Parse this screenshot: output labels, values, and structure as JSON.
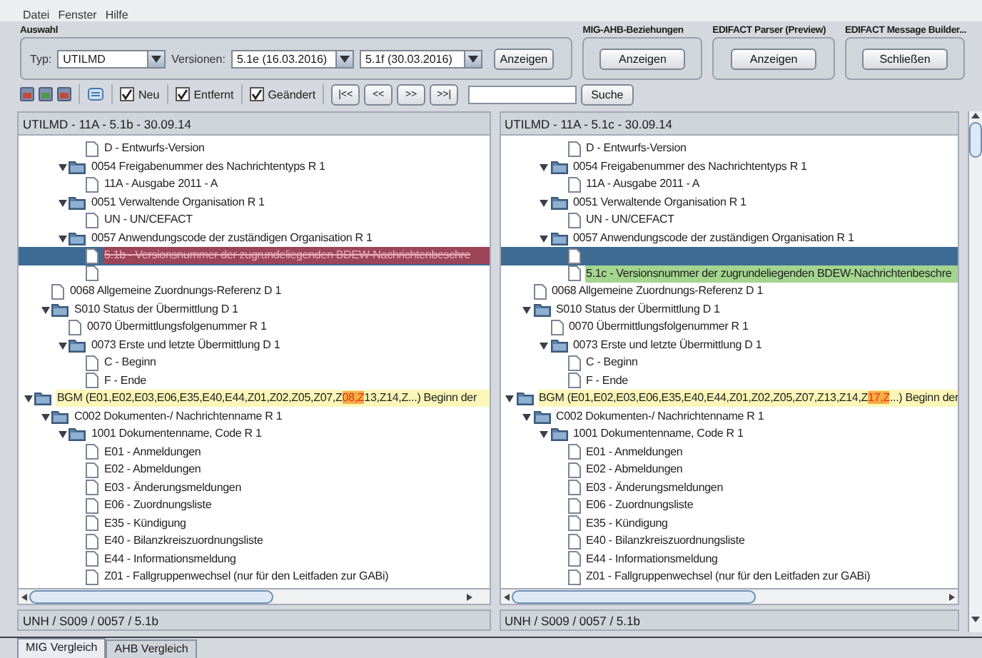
{
  "menu": [
    {
      "label": "Datei"
    },
    {
      "label": "Fenster"
    },
    {
      "label": "Hilfe"
    }
  ],
  "groups": [
    {
      "kind": "selection",
      "title": "Auswahl",
      "type_label": "Typ:",
      "type_value": "UTILMD",
      "versions_label": "Versionen:",
      "versions": [
        "5.1e (16.03.2016)",
        "5.1f (30.03.2016)"
      ],
      "button": "Anzeigen"
    },
    {
      "kind": "action",
      "title": "MIG-AHB-Beziehungen",
      "button": "Anzeigen"
    },
    {
      "kind": "action",
      "title": "EDIFACT Parser (Preview)",
      "button": "Anzeigen"
    },
    {
      "kind": "action",
      "title": "EDIFACT Message Builder...",
      "button": "Schließen"
    }
  ],
  "toolbar": {
    "filters": [
      {
        "label": "Neu",
        "checked": true
      },
      {
        "label": "Entfernt",
        "checked": true
      },
      {
        "label": "Geändert",
        "checked": true
      }
    ],
    "nav": [
      "|<<",
      "<<",
      ">>",
      ">>|"
    ],
    "search_button": "Suche"
  },
  "panes": [
    {
      "header": "UTILMD - 11A - 5.1b - 30.09.14",
      "status": "UNH / S009 / 0057 / 5.1b",
      "tree": [
        {
          "children": [
            {
              "children": [
                {
                  "children": [
                    {
                      "kind": "doc",
                      "label": "D - Entwurfs-Version",
                      "selected": false
                    }
                  ]
                },
                {
                  "kind": "folder",
                  "expanded": true,
                  "label": "0054 Freigabenummer des Nachrichtentyps R 1",
                  "selected": false,
                  "children": [
                    {
                      "kind": "doc",
                      "label": "11A - Ausgabe 2011 - A",
                      "selected": false
                    }
                  ]
                },
                {
                  "kind": "folder",
                  "expanded": true,
                  "label": "0051 Verwaltende Organisation R 1",
                  "selected": false,
                  "children": [
                    {
                      "kind": "doc",
                      "label": "UN - UN/CEFACT",
                      "selected": false
                    }
                  ]
                },
                {
                  "kind": "folder",
                  "expanded": true,
                  "label": "0057 Anwendungscode der zuständigen Organisation R 1",
                  "selected": false,
                  "children": [
                    {
                      "kind": "doc",
                      "label": "5.1b - Versionsnummer der zugrundeliegenden BDEW-Nachrichtenbeschre",
                      "selected": true,
                      "color": "#9c4458",
                      "crossed_out": true
                    },
                    {
                      "kind": "doc",
                      "selected": false
                    }
                  ]
                }
              ]
            },
            {
              "kind": "doc",
              "label": "0068 Allgemeine Zuordnungs-Referenz D 1",
              "selected": false
            },
            {
              "kind": "folder",
              "expanded": true,
              "label": "S010 Status der Übermittlung D 1",
              "selected": false,
              "children": [
                {
                  "kind": "doc",
                  "label": "0070 Übermittlungsfolgenummer R 1",
                  "selected": false
                },
                {
                  "kind": "folder",
                  "expanded": true,
                  "label": "0073 Erste und letzte Übermittlung D 1",
                  "selected": false,
                  "children": [
                    {
                      "kind": "doc",
                      "label": "C - Beginn",
                      "selected": false
                    },
                    {
                      "kind": "doc",
                      "label": "F - Ende",
                      "selected": false
                    }
                  ]
                }
              ]
            }
          ]
        },
        {
          "kind": "folder",
          "expanded": true,
          "selected": false,
          "color": "#fbf7b8",
          "parts": [
            {
              "text": "BGM (E01,E02,E03,E06,E35,E40,E44,Z01,Z02,Z05,Z07,Z",
              "highlighted": false
            },
            {
              "text": "08,Z",
              "highlighted": true
            },
            {
              "text": "13,Z14,Z...) Beginn der",
              "highlighted": false
            }
          ],
          "children": [
            {
              "kind": "folder",
              "expanded": true,
              "label": "C002 Dokumenten-/ Nachrichtenname R 1",
              "selected": false,
              "children": [
                {
                  "kind": "folder",
                  "expanded": true,
                  "label": "1001 Dokumentenname, Code R 1",
                  "selected": false,
                  "children": [
                    {
                      "kind": "doc",
                      "label": "E01 - Anmeldungen",
                      "selected": false
                    },
                    {
                      "kind": "doc",
                      "label": "E02 - Abmeldungen",
                      "selected": false
                    },
                    {
                      "kind": "doc",
                      "label": "E03 - Änderungsmeldungen",
                      "selected": false
                    },
                    {
                      "kind": "doc",
                      "label": "E06 - Zuordnungsliste",
                      "selected": false
                    },
                    {
                      "kind": "doc",
                      "label": "E35 - Kündigung",
                      "selected": false
                    },
                    {
                      "kind": "doc",
                      "label": "E40 - Bilanzkreiszuordnungsliste",
                      "selected": false
                    },
                    {
                      "kind": "doc",
                      "label": "E44 - Informationsmeldung",
                      "selected": false
                    },
                    {
                      "kind": "doc",
                      "label": "Z01 - Fallgruppenwechsel (nur für den Leitfaden zur GABi)",
                      "selected": false
                    }
                  ]
                }
              ]
            }
          ]
        }
      ]
    },
    {
      "header": "UTILMD - 11A - 5.1c - 30.09.14",
      "status": "UNH / S009 / 0057 / 5.1b",
      "tree": [
        {
          "children": [
            {
              "children": [
                {
                  "children": [
                    {
                      "kind": "doc",
                      "label": "D - Entwurfs-Version",
                      "selected": false
                    }
                  ]
                },
                {
                  "kind": "folder",
                  "expanded": true,
                  "label": "0054 Freigabenummer des Nachrichtentyps R 1",
                  "selected": false,
                  "children": [
                    {
                      "kind": "doc",
                      "label": "11A - Ausgabe 2011 - A",
                      "selected": false
                    }
                  ]
                },
                {
                  "kind": "folder",
                  "expanded": true,
                  "label": "0051 Verwaltende Organisation R 1",
                  "selected": false,
                  "children": [
                    {
                      "kind": "doc",
                      "label": "UN - UN/CEFACT",
                      "selected": false
                    }
                  ]
                },
                {
                  "kind": "folder",
                  "expanded": true,
                  "label": "0057 Anwendungscode der zuständigen Organisation R 1",
                  "selected": false,
                  "children": [
                    {
                      "kind": "doc",
                      "selected": true
                    },
                    {
                      "kind": "doc",
                      "label": "5.1c - Versionsnummer der zugrundeliegenden BDEW-Nachrichtenbeschre",
                      "selected": false,
                      "color": "#a3d58f"
                    }
                  ]
                }
              ]
            },
            {
              "kind": "doc",
              "label": "0068 Allgemeine Zuordnungs-Referenz D 1",
              "selected": false
            },
            {
              "kind": "folder",
              "expanded": true,
              "label": "S010 Status der Übermittlung D 1",
              "selected": false,
              "children": [
                {
                  "kind": "doc",
                  "label": "0070 Übermittlungsfolgenummer R 1",
                  "selected": false
                },
                {
                  "kind": "folder",
                  "expanded": true,
                  "label": "0073 Erste und letzte Übermittlung D 1",
                  "selected": false,
                  "children": [
                    {
                      "kind": "doc",
                      "label": "C - Beginn",
                      "selected": false
                    },
                    {
                      "kind": "doc",
                      "label": "F - Ende",
                      "selected": false
                    }
                  ]
                }
              ]
            }
          ]
        },
        {
          "kind": "folder",
          "expanded": true,
          "selected": false,
          "color": "#fbf7b8",
          "parts": [
            {
              "text": "BGM (E01,E02,E03,E06,E35,E40,E44,Z01,Z02,Z05,Z07,Z13,Z14,Z",
              "highlighted": false
            },
            {
              "text": "17,Z",
              "highlighted": true
            },
            {
              "text": "...) Beginn der",
              "highlighted": false
            }
          ],
          "children": [
            {
              "kind": "folder",
              "expanded": true,
              "label": "C002 Dokumenten-/ Nachrichtenname R 1",
              "selected": false,
              "children": [
                {
                  "kind": "folder",
                  "expanded": true,
                  "label": "1001 Dokumentenname, Code R 1",
                  "selected": false,
                  "children": [
                    {
                      "kind": "doc",
                      "label": "E01 - Anmeldungen",
                      "selected": false
                    },
                    {
                      "kind": "doc",
                      "label": "E02 - Abmeldungen",
                      "selected": false
                    },
                    {
                      "kind": "doc",
                      "label": "E03 - Änderungsmeldungen",
                      "selected": false
                    },
                    {
                      "kind": "doc",
                      "label": "E06 - Zuordnungsliste",
                      "selected": false
                    },
                    {
                      "kind": "doc",
                      "label": "E35 - Kündigung",
                      "selected": false
                    },
                    {
                      "kind": "doc",
                      "label": "E40 - Bilanzkreiszuordnungsliste",
                      "selected": false
                    },
                    {
                      "kind": "doc",
                      "label": "E44 - Informationsmeldung",
                      "selected": false
                    },
                    {
                      "kind": "doc",
                      "label": "Z01 - Fallgruppenwechsel (nur für den Leitfaden zur GABi)",
                      "selected": false
                    }
                  ]
                }
              ]
            }
          ]
        }
      ]
    }
  ],
  "tabs": [
    {
      "label": "MIG Vergleich",
      "selected": true
    },
    {
      "label": "AHB Vergleich",
      "selected": false
    }
  ]
}
